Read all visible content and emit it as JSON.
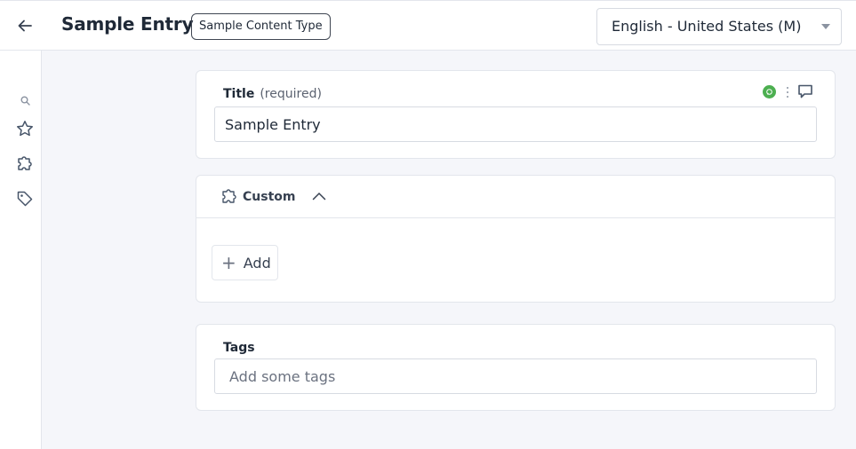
{
  "header": {
    "back_icon": "arrow-left-icon",
    "title": "Sample Entry",
    "content_type": "Sample Content Type",
    "locale": "English - United States (M)"
  },
  "sidebar": {
    "items": [
      {
        "icon": "search-icon"
      },
      {
        "icon": "star-icon"
      },
      {
        "icon": "puzzle-icon"
      },
      {
        "icon": "tag-icon"
      }
    ]
  },
  "title_field": {
    "label": "Title",
    "hint": "(required)",
    "value": "Sample Entry",
    "status_color": "#4caf50"
  },
  "custom_section": {
    "title": "Custom",
    "add_label": "Add"
  },
  "tags_field": {
    "label": "Tags",
    "placeholder": "Add some tags"
  }
}
